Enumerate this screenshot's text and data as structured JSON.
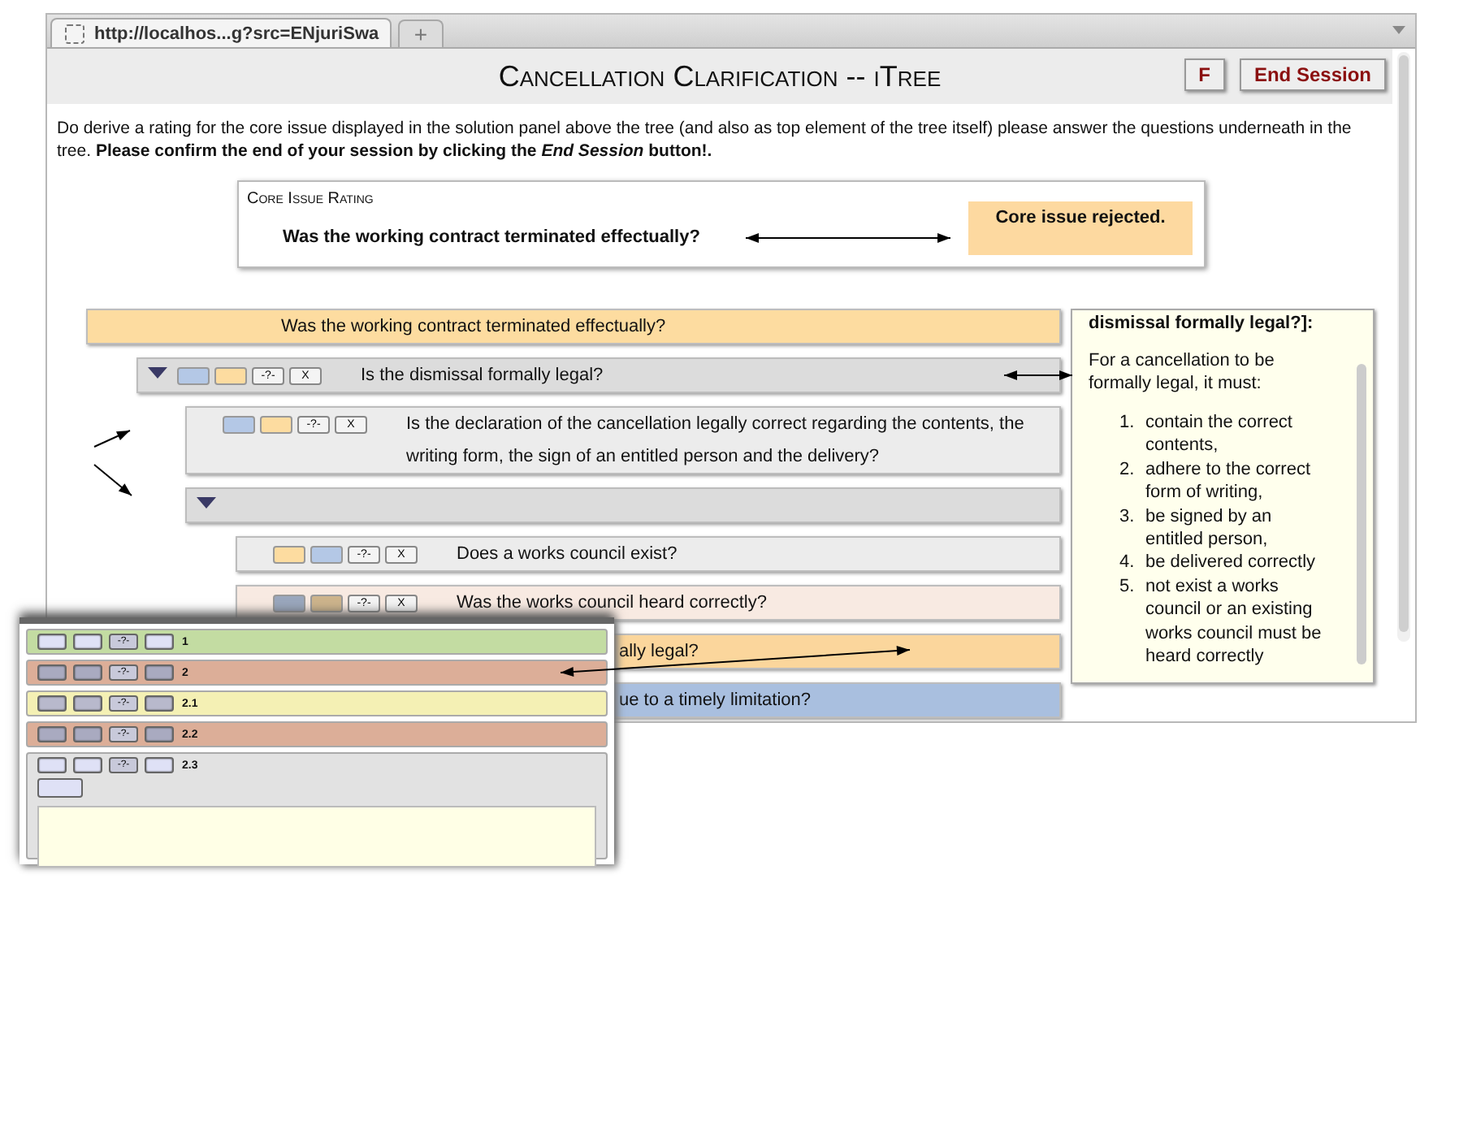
{
  "browser": {
    "tab_url": "http://localhos...g?src=ENjuriSwa",
    "new_tab": "+"
  },
  "header": {
    "title": "Cancellation Clarification -- iTree",
    "buttons": [
      {
        "label": "F"
      },
      {
        "label": "End Session"
      }
    ]
  },
  "instructions": {
    "text": "Do derive a rating for the core issue displayed in the solution panel above the tree (and also as top element of the tree itself) please answer the questions underneath in the tree.",
    "confirm": "Please confirm the end of your session by clicking the *End Session* button!."
  },
  "core_issue": {
    "label": "Core Issue Rating",
    "question": "Was the working contract terminated effectually?",
    "result": "Core issue rejected."
  },
  "tree": [
    {
      "text": "Was the working contract terminated effectually?",
      "color": "#fddca0",
      "children": [
        {
          "text": "Is the dismissal formally legal?",
          "color": "#dcdcdc",
          "expanded": true,
          "buttons": [
            {
              "kind": "swatch",
              "color": "#b4c8e6"
            },
            {
              "kind": "swatch",
              "color": "#fddca0"
            },
            {
              "kind": "label",
              "label": "-?-"
            },
            {
              "kind": "label",
              "label": "X"
            }
          ],
          "children": [
            {
              "text": "Is the declaration of the cancellation legally correct regarding the contents, the writing form, the sign of an entitled person and the delivery?",
              "color": "#ececec",
              "buttons": [
                {
                  "kind": "swatch",
                  "color": "#b4c8e6"
                },
                {
                  "kind": "swatch",
                  "color": "#fddca0"
                },
                {
                  "kind": "label",
                  "label": "-?-"
                },
                {
                  "kind": "label",
                  "label": "X"
                }
              ]
            },
            {
              "color": "#dcdcdc",
              "expanded": true,
              "children": [
                {
                  "text": "Does a works council exist?",
                  "color": "#ececec",
                  "buttons": [
                    {
                      "kind": "swatch",
                      "color": "#fddca0"
                    },
                    {
                      "kind": "swatch",
                      "color": "#b4c8e6"
                    },
                    {
                      "kind": "label",
                      "label": "-?-"
                    },
                    {
                      "kind": "label",
                      "label": "X"
                    }
                  ]
                },
                {
                  "text": "Was the works council heard correctly?",
                  "color": "#f8eae2",
                  "buttons": [
                    {
                      "kind": "swatch",
                      "color": "#9aa7bd"
                    },
                    {
                      "kind": "swatch",
                      "color": "#cdb48c"
                    },
                    {
                      "kind": "label",
                      "label": "-?-"
                    },
                    {
                      "kind": "label",
                      "label": "X"
                    }
                  ]
                }
              ]
            },
            {
              "text": "ally legal?",
              "color": "#fbd69c"
            },
            {
              "text": "ue to a timely limitation?",
              "color": "#a9bfdf"
            }
          ]
        }
      ]
    }
  ],
  "info_panel": {
    "heading": "dismissal formally legal?]:",
    "intro": "For a cancellation to be formally legal, it must:",
    "items": [
      {
        "number": "1.",
        "text": "contain the correct contents,"
      },
      {
        "number": "2.",
        "text": "adhere to the correct form of writing,"
      },
      {
        "number": "3.",
        "text": "be signed by an entitled person,"
      },
      {
        "number": "4.",
        "text": "be delivered correctly"
      },
      {
        "number": "5.",
        "text": "not exist a works council or an existing works council must be heard correctly"
      }
    ]
  },
  "inset": {
    "rows": [
      {
        "label": "1",
        "color": "#c3dca2",
        "kind": "plain",
        "buttons": [
          {
            "kind": "swatch",
            "color": "#dfe1f6"
          },
          {
            "kind": "swatch",
            "color": "#dfe1f6"
          },
          {
            "kind": "label",
            "label": "-?-"
          },
          {
            "kind": "swatch",
            "color": "#dfe1f6"
          }
        ]
      },
      {
        "label": "2",
        "color": "#dcae98",
        "kind": "plain",
        "buttons": [
          {
            "kind": "swatch",
            "color": "#a9aac0"
          },
          {
            "kind": "swatch",
            "color": "#a9aac0"
          },
          {
            "kind": "label",
            "label": "-?-"
          },
          {
            "kind": "swatch",
            "color": "#a9aac0"
          }
        ]
      },
      {
        "label": "2.1",
        "color": "#f4f0b4",
        "kind": "plain",
        "buttons": [
          {
            "kind": "swatch",
            "color": "#b8b9cc"
          },
          {
            "kind": "swatch",
            "color": "#b8b9cc"
          },
          {
            "kind": "label",
            "label": "-?-"
          },
          {
            "kind": "swatch",
            "color": "#b8b9cc"
          }
        ]
      },
      {
        "label": "2.2",
        "color": "#dcae98",
        "kind": "plain",
        "buttons": [
          {
            "kind": "swatch",
            "color": "#a9aac0"
          },
          {
            "kind": "swatch",
            "color": "#a9aac0"
          },
          {
            "kind": "label",
            "label": "-?-"
          },
          {
            "kind": "swatch",
            "color": "#a9aac0"
          }
        ]
      },
      {
        "label": "2.3",
        "color": "#e2e2e2",
        "kind": "editor",
        "buttons": [
          {
            "kind": "swatch",
            "color": "#dfe1f6"
          },
          {
            "kind": "swatch",
            "color": "#dfe1f6"
          },
          {
            "kind": "label",
            "label": "-?-"
          },
          {
            "kind": "swatch",
            "color": "#dfe1f6"
          }
        ]
      }
    ]
  }
}
